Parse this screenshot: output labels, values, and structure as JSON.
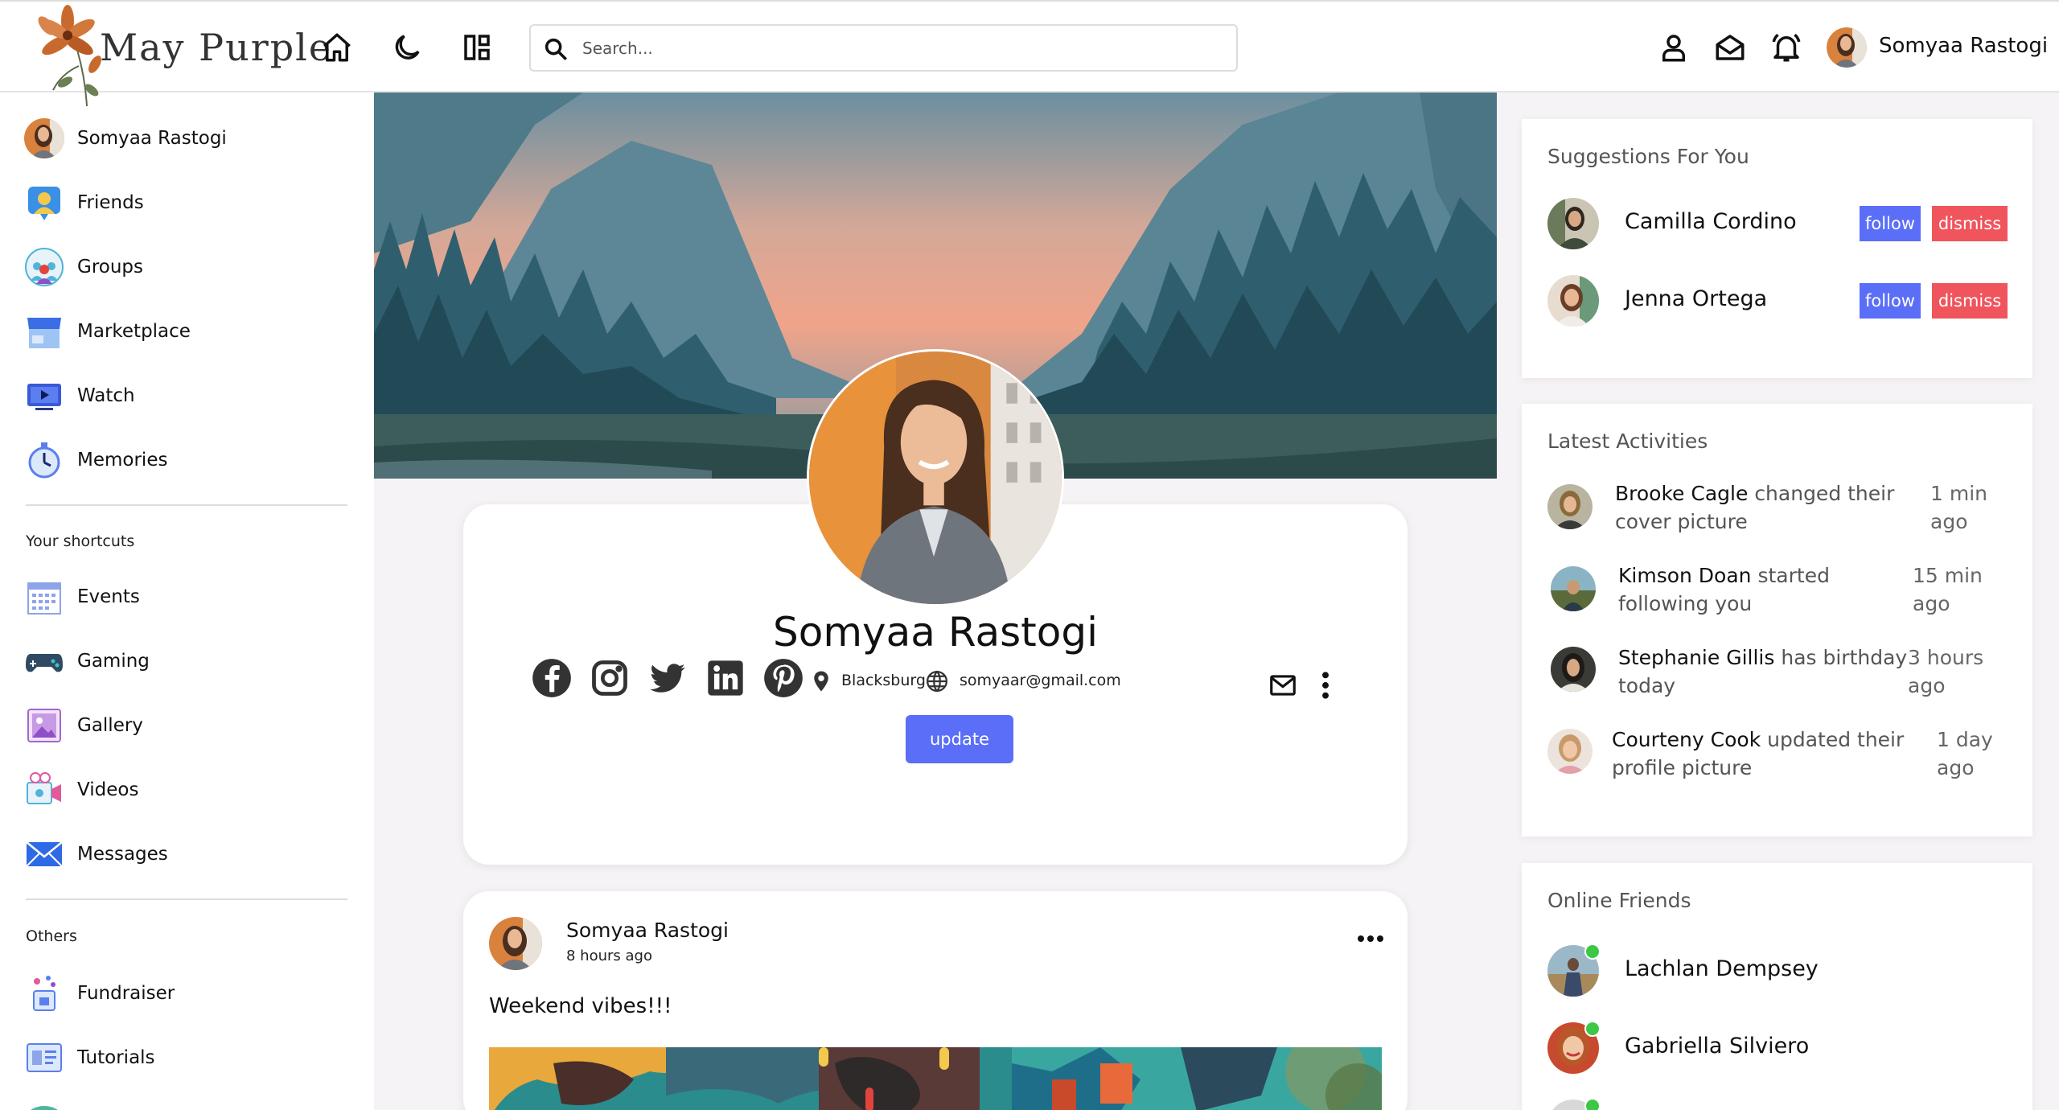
{
  "app": {
    "logo_text": "May Purple",
    "search_placeholder": "Search...",
    "user_name": "Somyaa Rastogi"
  },
  "sidebar": {
    "items": [
      {
        "label": "Somyaa Rastogi",
        "icon": "avatar"
      },
      {
        "label": "Friends",
        "icon": "friends-icon"
      },
      {
        "label": "Groups",
        "icon": "groups-icon"
      },
      {
        "label": "Marketplace",
        "icon": "marketplace-icon"
      },
      {
        "label": "Watch",
        "icon": "watch-icon"
      },
      {
        "label": "Memories",
        "icon": "memories-icon"
      }
    ],
    "shortcuts_title": "Your shortcuts",
    "shortcuts": [
      {
        "label": "Events",
        "icon": "events-icon"
      },
      {
        "label": "Gaming",
        "icon": "gaming-icon"
      },
      {
        "label": "Gallery",
        "icon": "gallery-icon"
      },
      {
        "label": "Videos",
        "icon": "videos-icon"
      },
      {
        "label": "Messages",
        "icon": "messages-icon"
      }
    ],
    "others_title": "Others",
    "others": [
      {
        "label": "Fundraiser",
        "icon": "fundraiser-icon"
      },
      {
        "label": "Tutorials",
        "icon": "tutorials-icon"
      }
    ]
  },
  "profile": {
    "name": "Somyaa Rastogi",
    "location": "Blacksburg",
    "email": "somyaar@gmail.com",
    "update_label": "update"
  },
  "post": {
    "author": "Somyaa Rastogi",
    "time": "8 hours ago",
    "text": "Weekend vibes!!!"
  },
  "suggestions": {
    "title": "Suggestions For You",
    "follow_label": "follow",
    "dismiss_label": "dismiss",
    "people": [
      {
        "name": "Camilla Cordino"
      },
      {
        "name": "Jenna Ortega"
      }
    ]
  },
  "activities": {
    "title": "Latest Activities",
    "items": [
      {
        "who": "Brooke Cagle",
        "action": "changed their cover picture",
        "time": "1 min ago"
      },
      {
        "who": "Kimson Doan",
        "action": "started following you",
        "time": "15 min ago"
      },
      {
        "who": "Stephanie Gillis",
        "action": "has birthday today",
        "time": "3 hours ago"
      },
      {
        "who": "Courteny Cook",
        "action": "updated their profile picture",
        "time": "1 day ago"
      }
    ]
  },
  "online": {
    "title": "Online Friends",
    "friends": [
      {
        "name": "Lachlan Dempsey"
      },
      {
        "name": "Gabriella Silviero"
      }
    ]
  },
  "colors": {
    "primary": "#5a6ef8",
    "danger": "#f0545c",
    "online": "#3cc745"
  }
}
